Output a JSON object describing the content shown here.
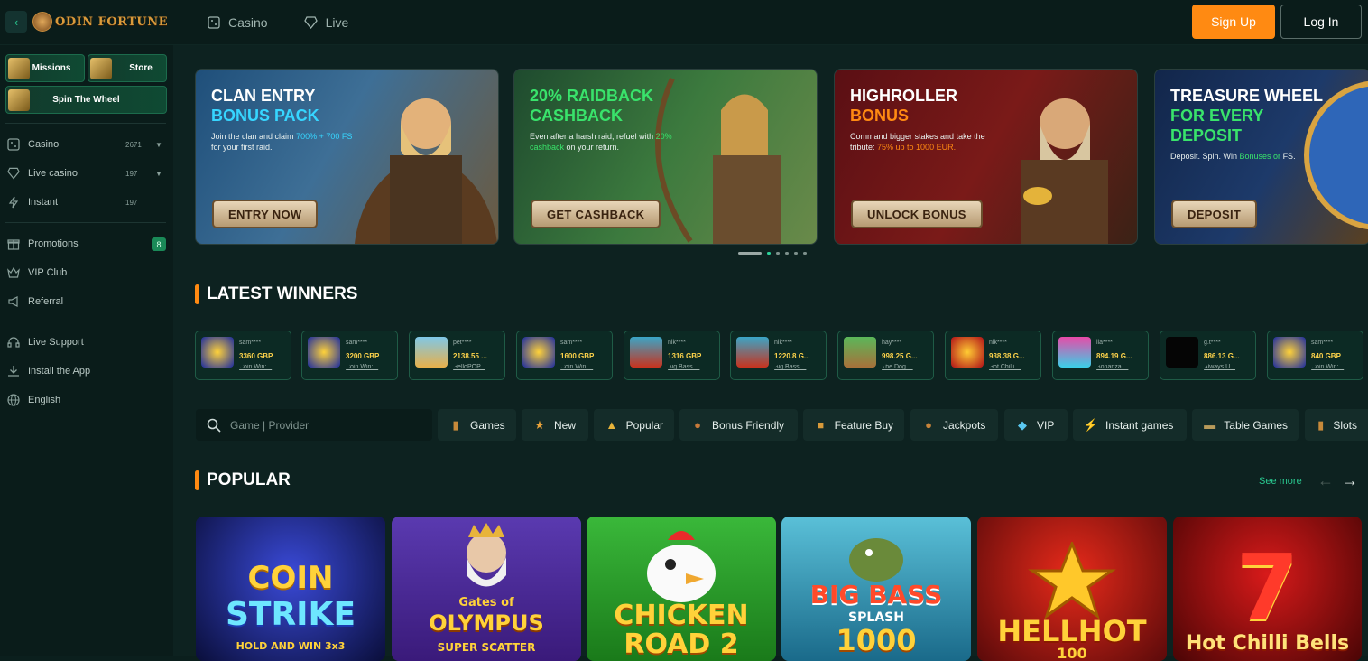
{
  "header": {
    "brand": "ODIN FORTUNE",
    "nav": [
      {
        "label": "Casino",
        "icon": "dice-icon"
      },
      {
        "label": "Live",
        "icon": "diamond-icon"
      }
    ],
    "signup_label": "Sign Up",
    "login_label": "Log In",
    "accent": "#ff8a12"
  },
  "sidebar": {
    "promos": {
      "missions": "Missions",
      "store": "Store",
      "wheel": "Spin The Wheel"
    },
    "items": [
      {
        "label": "Casino",
        "count": "2671",
        "icon": "dice-icon"
      },
      {
        "label": "Live casino",
        "count": "197",
        "icon": "diamond-icon"
      },
      {
        "label": "Instant",
        "count": "197",
        "icon": "lightning-icon"
      },
      {
        "label": "Promotions",
        "badge": "8",
        "icon": "gift-icon"
      },
      {
        "label": "VIP Club",
        "icon": "crown-icon"
      },
      {
        "label": "Referral",
        "icon": "megaphone-icon"
      },
      {
        "label": "Live Support",
        "icon": "headset-icon"
      },
      {
        "label": "Install the App",
        "icon": "download-icon"
      },
      {
        "label": "English",
        "icon": "globe-icon"
      }
    ]
  },
  "banners": [
    {
      "title1": "CLAN ENTRY",
      "title2": "BONUS PACK",
      "body_a": "Join the clan and claim ",
      "body_hl": "700% + 700 FS",
      "body_b": " for your first raid.",
      "cta": "ENTRY NOW",
      "accent": "#36d6ff"
    },
    {
      "title1": "20% RAIDBACK",
      "title2": "CASHBACK",
      "body_a": "Even after a harsh raid, refuel with ",
      "body_hl": "20% cashback",
      "body_b": " on your return.",
      "cta": "GET CASHBACK",
      "accent": "#39e36b"
    },
    {
      "title1": "HIGHROLLER",
      "title2": "BONUS",
      "body_a": "Command bigger stakes and take the tribute: ",
      "body_hl": "75% up to 1000 EUR.",
      "body_b": "",
      "cta": "UNLOCK BONUS",
      "accent": "#ff8a12"
    },
    {
      "title1": "TREASURE WHEEL",
      "title2": "FOR EVERY",
      "title3": "DEPOSIT",
      "body_a": "Deposit. Spin. Win ",
      "body_hl": "Bonuses or",
      "body_b": " FS.",
      "cta": "DEPOSIT",
      "accent": "#39e36b"
    }
  ],
  "latest_winners": {
    "title": "LATEST WINNERS",
    "items": [
      {
        "user": "sam****",
        "amount": "3360 GBP",
        "game": "Coin Win:..."
      },
      {
        "user": "sam****",
        "amount": "3200 GBP",
        "game": "Coin Win:..."
      },
      {
        "user": "pet****",
        "amount": "2138.55 ...",
        "game": "HelloPOP..."
      },
      {
        "user": "sam****",
        "amount": "1600 GBP",
        "game": "Coin Win:..."
      },
      {
        "user": "nik****",
        "amount": "1316 GBP",
        "game": "Big Bass ..."
      },
      {
        "user": "nik****",
        "amount": "1220.8 G...",
        "game": "Big Bass ..."
      },
      {
        "user": "hay****",
        "amount": "998.25 G...",
        "game": "The Dog ..."
      },
      {
        "user": "nik****",
        "amount": "938.38 G...",
        "game": "Hot Chilli ..."
      },
      {
        "user": "lia****",
        "amount": "894.19 G...",
        "game": "Bonanza ..."
      },
      {
        "user": "g.t****",
        "amount": "886.13 G...",
        "game": "Always U..."
      },
      {
        "user": "sam****",
        "amount": "840 GBP",
        "game": "Coin Win:..."
      }
    ]
  },
  "search": {
    "placeholder": "Game | Provider"
  },
  "categories": [
    {
      "label": "Games",
      "icon": "barrel-icon"
    },
    {
      "label": "New",
      "icon": "star-icon"
    },
    {
      "label": "Popular",
      "icon": "trophy-icon"
    },
    {
      "label": "Bonus Friendly",
      "icon": "cauldron-icon"
    },
    {
      "label": "Feature Buy",
      "icon": "chest-icon"
    },
    {
      "label": "Jackpots",
      "icon": "pot-icon"
    },
    {
      "label": "VIP",
      "icon": "gem-icon"
    },
    {
      "label": "Instant games",
      "icon": "lightning-icon"
    },
    {
      "label": "Table Games",
      "icon": "table-icon"
    },
    {
      "label": "Slots",
      "icon": "barrel-icon"
    }
  ],
  "popular": {
    "title": "POPULAR",
    "see_more": "See more",
    "games": [
      {
        "line1": "COIN",
        "line2": "STRIKE",
        "line3": "HOLD AND WIN 3x3"
      },
      {
        "line1": "Gates of",
        "line2": "OLYMPUS",
        "line3": "SUPER SCATTER"
      },
      {
        "line1": "CHICKEN",
        "line2": "ROAD 2",
        "line3": ""
      },
      {
        "line1": "BIG BASS",
        "line2": "SPLASH",
        "line3": "1000"
      },
      {
        "line1": "HELLHOT",
        "line2": "100",
        "line3": ""
      },
      {
        "line1": "Hot Chilli Bells",
        "line2": "",
        "line3": ""
      }
    ]
  }
}
